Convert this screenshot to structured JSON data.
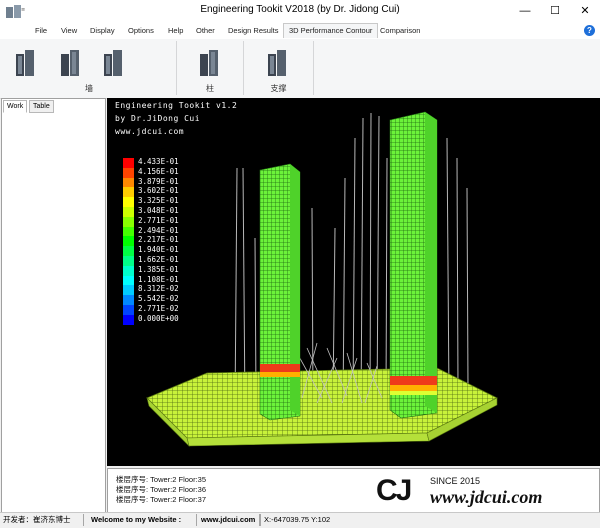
{
  "window": {
    "title": "Engineering Tookit V2018 (by Dr. Jidong Cui)",
    "minimize_glyph": "—",
    "maximize_glyph": "☐",
    "close_glyph": "✕"
  },
  "menu": {
    "items": [
      "File",
      "View",
      "Display",
      "Options",
      "Help",
      "Other",
      "Design Results",
      "3D Performance Contour",
      "Comparison"
    ],
    "help_glyph": "?"
  },
  "ribbon": {
    "groups": [
      {
        "label": "墙"
      },
      {
        "label": "柱"
      },
      {
        "label": "支撑"
      }
    ]
  },
  "left_panel": {
    "tabs": [
      "Work",
      "Table"
    ]
  },
  "viewport": {
    "header_lines": [
      "Engineering Tookit v1.2",
      "by Dr.JiDong Cui",
      "www.jdcui.com"
    ],
    "legend": {
      "labels": [
        "4.433E-01",
        "4.156E-01",
        "3.879E-01",
        "3.602E-01",
        "3.325E-01",
        "3.048E-01",
        "2.771E-01",
        "2.494E-01",
        "2.217E-01",
        "1.940E-01",
        "1.662E-01",
        "1.385E-01",
        "1.108E-01",
        "8.312E-02",
        "5.542E-02",
        "2.771E-02",
        "0.000E+00"
      ],
      "colors": [
        "#ff0000",
        "#ff4400",
        "#ff8800",
        "#ffcc00",
        "#ffff00",
        "#ccff00",
        "#88ff00",
        "#44ff00",
        "#00ff00",
        "#00ff44",
        "#00ff88",
        "#00ffcc",
        "#00ffff",
        "#00ccff",
        "#0088ff",
        "#0044ff",
        "#0000ff"
      ]
    }
  },
  "output": {
    "lines": [
      "楼层序号: Tower:2 Floor:35",
      "楼层序号: Tower:2 Floor:36",
      "楼层序号: Tower:2 Floor:37"
    ]
  },
  "watermark": {
    "logo_text": "CJ",
    "since": "SINCE 2015",
    "url": "www.jdcui.com"
  },
  "status": {
    "developer": "开发者：崔济东博士",
    "welcome": "Welcome to my Website :",
    "website": "www.jdcui.com",
    "coords": "X:-647039.75 Y:102"
  }
}
